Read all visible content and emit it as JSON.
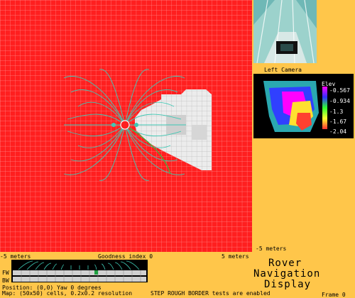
{
  "map": {
    "x_left_label": "-5 meters",
    "x_right_label": "5 meters",
    "y_bottom_label": "-5 meters",
    "goodness_label": "Goodness index 0",
    "grid_color": "#ffffff",
    "blocked_color": "#ff1f1f",
    "free_color": "#ececec",
    "arc_color": "#3ec8b4"
  },
  "camera": {
    "label": "Left Camera"
  },
  "elevation": {
    "title": "Elev",
    "ticks": [
      "-0.567",
      "-0.934",
      "-1.3",
      "-1.67",
      "-2.04"
    ]
  },
  "ruler": {
    "fw_label": "FW",
    "bw_label": "BW"
  },
  "status": {
    "position": "Position: (0,0) Yaw   0  degrees",
    "map_info": "Map: (50x50) cells, 0.2x0.2 resolution",
    "tests": "STEP ROUGH BORDER tests are enabled",
    "frame": "Frame  0"
  },
  "title": {
    "line1": "Rover",
    "line2": "Navigation",
    "line3": "Display"
  }
}
